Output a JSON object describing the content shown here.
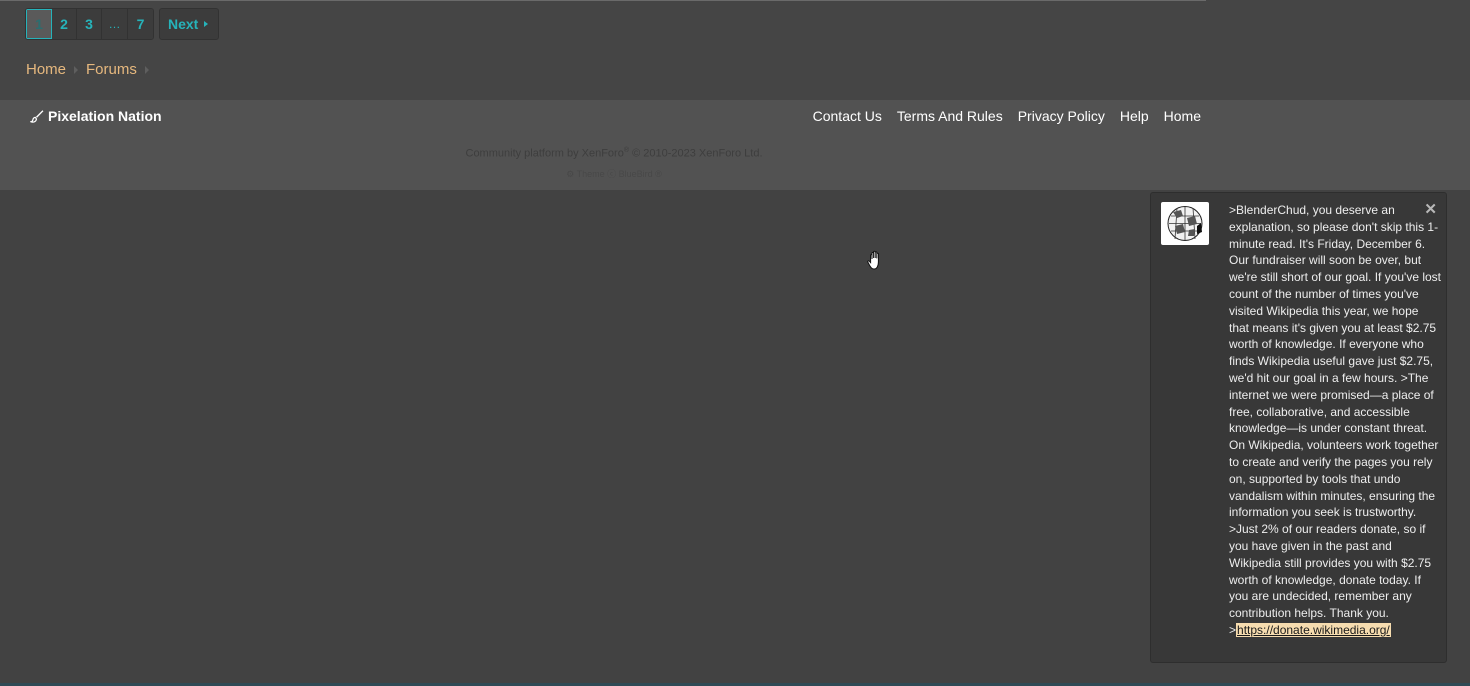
{
  "pagination": {
    "pages": [
      "1",
      "2",
      "3",
      "…",
      "7"
    ],
    "current": "1",
    "next_label": "Next"
  },
  "breadcrumb": {
    "items": [
      "Home",
      "Forums"
    ]
  },
  "footer": {
    "brand": "Pixelation Nation",
    "links": [
      "Contact Us",
      "Terms And Rules",
      "Privacy Policy",
      "Help",
      "Home"
    ],
    "copyright_prefix": "Community platform by XenForo",
    "copyright_mark": "®",
    "copyright_suffix": "© 2010-2023 XenForo Ltd.",
    "theme_credit": "⚙ Theme ⓒ BlueBird ®"
  },
  "notification": {
    "message": ">BlenderChud, you deserve an explanation, so please don't skip this 1-minute read. It's Friday, December 6. Our fundraiser will soon be over, but we're still short of our goal. If you've lost count of the number of times you've visited Wikipedia this year, we hope that means it's given you at least $2.75 worth of knowledge. If everyone who finds Wikipedia useful gave just $2.75, we'd hit our goal in a few hours. >The internet we were promised—a place of free, collaborative, and accessible knowledge—is under constant threat. On Wikipedia, volunteers work together to create and verify the pages you rely on, supported by tools that undo vandalism within minutes, ensuring the information you seek is trustworthy. >Just 2% of our readers donate, so if you have given in the past and Wikipedia still provides you with $2.75 worth of knowledge, donate today. If you are undecided, remember any contribution helps. Thank you.",
    "link_prefix": ">",
    "link": "https://donate.wikimedia.org/",
    "close": "✕",
    "icon": "wikipedia-globe-icon"
  },
  "colors": {
    "accent": "#26b3ba",
    "breadcrumb": "#e6b87e",
    "footer_bg": "#525252",
    "page_bg": "#424242",
    "link_highlight": "#f6dcaf"
  }
}
